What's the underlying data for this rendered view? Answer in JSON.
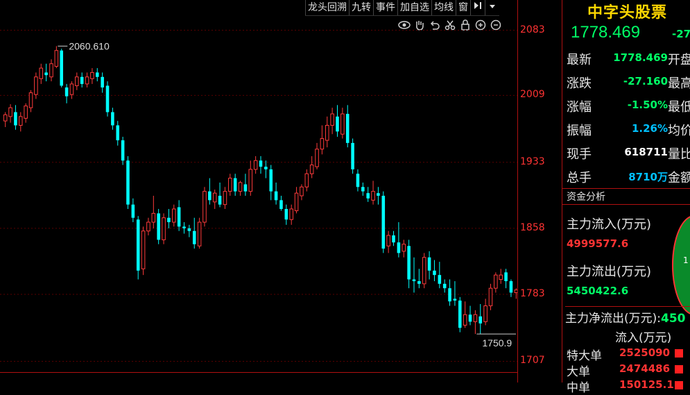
{
  "toolbar": {
    "items": [
      "龙头回溯",
      "九转",
      "事件",
      "加自选",
      "均线",
      "窗"
    ],
    "icons": [
      "collapse-right-icon",
      "dropdown-arrow-icon"
    ]
  },
  "chart_tools": [
    "eye-icon",
    "hand-icon",
    "undo-icon",
    "scissors-icon",
    "lock-icon",
    "zoom-in-icon",
    "zoom-out-icon"
  ],
  "colors": {
    "up": "#ff3b3b",
    "down": "#00ffff",
    "grid": "#5a0000",
    "background": "#000000",
    "accent": "#ffd700"
  },
  "chart_data": {
    "type": "candlestick",
    "ylim": [
      1690,
      2100
    ],
    "y_ticks": [
      "2083",
      "2009",
      "1933",
      "1858",
      "1783",
      "1707"
    ],
    "annotations": {
      "high_label": "2060.610",
      "low_label": "1750.9"
    },
    "candles": [
      [
        1980,
        1987,
        1973,
        1990
      ],
      [
        1985,
        1995,
        1978,
        1999
      ],
      [
        1990,
        1975,
        1970,
        1998
      ],
      [
        1975,
        1985,
        1968,
        1990
      ],
      [
        1983,
        1997,
        1978,
        2000
      ],
      [
        1995,
        2012,
        1990,
        2015
      ],
      [
        2010,
        2030,
        2005,
        2035
      ],
      [
        2028,
        2040,
        2022,
        2045
      ],
      [
        2035,
        2032,
        2025,
        2045
      ],
      [
        2030,
        2045,
        2025,
        2050
      ],
      [
        2042,
        2060,
        2040,
        2065
      ],
      [
        2060,
        2020,
        2018,
        2062
      ],
      [
        2018,
        2008,
        2000,
        2022
      ],
      [
        2010,
        2022,
        2005,
        2025
      ],
      [
        2020,
        2030,
        2015,
        2035
      ],
      [
        2030,
        2022,
        2018,
        2035
      ],
      [
        2022,
        2030,
        2018,
        2035
      ],
      [
        2028,
        2035,
        2022,
        2040
      ],
      [
        2035,
        2030,
        2025,
        2040
      ],
      [
        2030,
        2018,
        2012,
        2035
      ],
      [
        2020,
        1990,
        1985,
        2025
      ],
      [
        1990,
        1975,
        1970,
        1995
      ],
      [
        1975,
        1958,
        1952,
        1980
      ],
      [
        1958,
        1935,
        1930,
        1962
      ],
      [
        1935,
        1885,
        1880,
        1940
      ],
      [
        1885,
        1870,
        1865,
        1892
      ],
      [
        1868,
        1810,
        1800,
        1872
      ],
      [
        1812,
        1855,
        1805,
        1860
      ],
      [
        1855,
        1865,
        1850,
        1870
      ],
      [
        1865,
        1875,
        1858,
        1895
      ],
      [
        1875,
        1845,
        1840,
        1880
      ],
      [
        1845,
        1870,
        1840,
        1875
      ],
      [
        1870,
        1865,
        1858,
        1880
      ],
      [
        1865,
        1880,
        1860,
        1885
      ],
      [
        1882,
        1860,
        1855,
        1890
      ],
      [
        1860,
        1858,
        1852,
        1865
      ],
      [
        1858,
        1855,
        1848,
        1862
      ],
      [
        1855,
        1840,
        1835,
        1870
      ],
      [
        1838,
        1865,
        1835,
        1870
      ],
      [
        1865,
        1900,
        1860,
        1905
      ],
      [
        1900,
        1890,
        1885,
        1915
      ],
      [
        1888,
        1898,
        1880,
        1902
      ],
      [
        1895,
        1885,
        1882,
        1910
      ],
      [
        1885,
        1900,
        1880,
        1905
      ],
      [
        1900,
        1915,
        1895,
        1920
      ],
      [
        1915,
        1900,
        1895,
        1920
      ],
      [
        1900,
        1910,
        1895,
        1912
      ],
      [
        1908,
        1900,
        1895,
        1920
      ],
      [
        1900,
        1925,
        1895,
        1935
      ],
      [
        1925,
        1935,
        1920,
        1940
      ],
      [
        1935,
        1928,
        1920,
        1940
      ],
      [
        1928,
        1925,
        1915,
        1935
      ],
      [
        1925,
        1900,
        1890,
        1930
      ],
      [
        1900,
        1890,
        1885,
        1910
      ],
      [
        1890,
        1880,
        1878,
        1895
      ],
      [
        1880,
        1868,
        1862,
        1885
      ],
      [
        1868,
        1880,
        1862,
        1885
      ],
      [
        1878,
        1898,
        1875,
        1905
      ],
      [
        1895,
        1905,
        1890,
        1908
      ],
      [
        1905,
        1920,
        1900,
        1925
      ],
      [
        1920,
        1930,
        1915,
        1940
      ],
      [
        1928,
        1948,
        1925,
        1955
      ],
      [
        1948,
        1960,
        1942,
        1975
      ],
      [
        1958,
        1975,
        1950,
        1985
      ],
      [
        1975,
        1988,
        1965,
        1995
      ],
      [
        1985,
        1968,
        1962,
        1998
      ],
      [
        1965,
        1988,
        1960,
        1995
      ],
      [
        1988,
        1955,
        1950,
        1998
      ],
      [
        1955,
        1925,
        1920,
        1960
      ],
      [
        1920,
        1905,
        1900,
        1925
      ],
      [
        1905,
        1900,
        1895,
        1910
      ],
      [
        1898,
        1892,
        1888,
        1905
      ],
      [
        1890,
        1900,
        1885,
        1912
      ],
      [
        1898,
        1895,
        1885,
        1905
      ],
      [
        1895,
        1835,
        1830,
        1900
      ],
      [
        1838,
        1850,
        1830,
        1855
      ],
      [
        1850,
        1842,
        1838,
        1855
      ],
      [
        1842,
        1830,
        1825,
        1865
      ],
      [
        1832,
        1840,
        1825,
        1845
      ],
      [
        1838,
        1800,
        1790,
        1845
      ],
      [
        1800,
        1798,
        1785,
        1825
      ],
      [
        1798,
        1795,
        1790,
        1812
      ],
      [
        1795,
        1825,
        1790,
        1830
      ],
      [
        1825,
        1810,
        1800,
        1832
      ],
      [
        1810,
        1805,
        1798,
        1822
      ],
      [
        1805,
        1795,
        1790,
        1820
      ],
      [
        1795,
        1790,
        1785,
        1800
      ],
      [
        1790,
        1775,
        1770,
        1800
      ],
      [
        1778,
        1776,
        1770,
        1798
      ],
      [
        1776,
        1745,
        1740,
        1780
      ],
      [
        1748,
        1760,
        1745,
        1775
      ],
      [
        1760,
        1752,
        1748,
        1770
      ],
      [
        1752,
        1760,
        1738,
        1765
      ],
      [
        1758,
        1750,
        1738,
        1772
      ],
      [
        1752,
        1770,
        1748,
        1778
      ],
      [
        1770,
        1790,
        1765,
        1795
      ],
      [
        1790,
        1805,
        1785,
        1808
      ],
      [
        1800,
        1805,
        1795,
        1812
      ],
      [
        1808,
        1798,
        1790,
        1812
      ],
      [
        1798,
        1785,
        1780,
        1800
      ],
      [
        1785,
        1788,
        1778,
        1790
      ]
    ]
  },
  "quote": {
    "name": "中字头股票",
    "price": "1778.469",
    "change_short": "-27",
    "rows": [
      {
        "label": "最新",
        "value": "1778.469",
        "color": "#00ff66",
        "tail": "开盘"
      },
      {
        "label": "涨跌",
        "value": "-27.160",
        "color": "#00ff66",
        "tail": "最高"
      },
      {
        "label": "涨幅",
        "value": "-1.50%",
        "color": "#00ff66",
        "tail": "最低"
      },
      {
        "label": "振幅",
        "value": "1.26%",
        "color": "#00c0ff",
        "tail": "均价"
      },
      {
        "label": "现手",
        "value": "618711",
        "color": "#ffffff",
        "tail": "量比"
      },
      {
        "label": "总手",
        "value": "8710万",
        "color": "#00c0ff",
        "tail": "金额"
      }
    ]
  },
  "funds": {
    "title": "资金分析",
    "inflow_label": "主力流入(万元)",
    "inflow_value": "4999577.6",
    "outflow_label": "主力流出(万元)",
    "outflow_value": "5450422.6",
    "net_label": "主力净流出(万元):",
    "net_value": "450",
    "pie_text": "1",
    "table_head": "流入(万元)",
    "rows": [
      {
        "label": "特大单",
        "value": "2525090"
      },
      {
        "label": "大单",
        "value": "2474486"
      },
      {
        "label": "中单",
        "value": "150125.1"
      }
    ]
  }
}
